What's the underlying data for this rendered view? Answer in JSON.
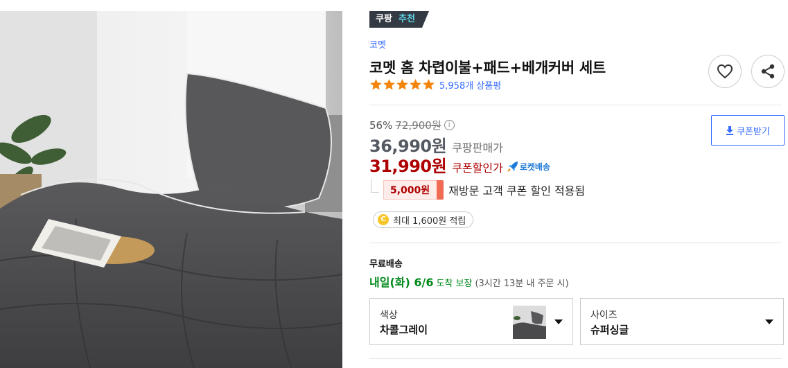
{
  "product": {
    "badge_left": "쿠팡",
    "badge_right": "추천",
    "brand": "코멧",
    "title": "코멧 홈 차렵이불+패드+베개커버 세트",
    "rating_stars": 5,
    "review_count": "5,958개 상품평"
  },
  "actions": {
    "wishlist_icon": "heart-icon",
    "share_icon": "share-icon"
  },
  "pricing": {
    "discount_rate": "56%",
    "original_price": "72,900원",
    "info_glyph": "i",
    "sale_price": "36,990원",
    "sale_label": "쿠팡판매가",
    "coupon_price": "31,990원",
    "coupon_label": "쿠폰할인가",
    "rocket_label": "로켓배송",
    "coupon_button": "쿠폰받기"
  },
  "revisit_coupon": {
    "amount": "5,000원",
    "text": "재방문 고객 쿠폰 할인 적용됨"
  },
  "points": {
    "coin_glyph": "C",
    "text": "최대 1,600원 적립"
  },
  "shipping": {
    "title": "무료배송",
    "day": "내일(화) 6/6",
    "arrival": "도착 보장",
    "note": "(3시간 13분 내 주문 시)"
  },
  "options": {
    "color_label": "색상",
    "color_value": "차콜그레이",
    "size_label": "사이즈",
    "size_value": "슈퍼싱글"
  },
  "colors": {
    "accent_blue": "#346aff",
    "price_red": "#ae0000",
    "delivery_green": "#00891a",
    "star_orange": "#f2850e",
    "charcoal": "#4a4a4c"
  }
}
